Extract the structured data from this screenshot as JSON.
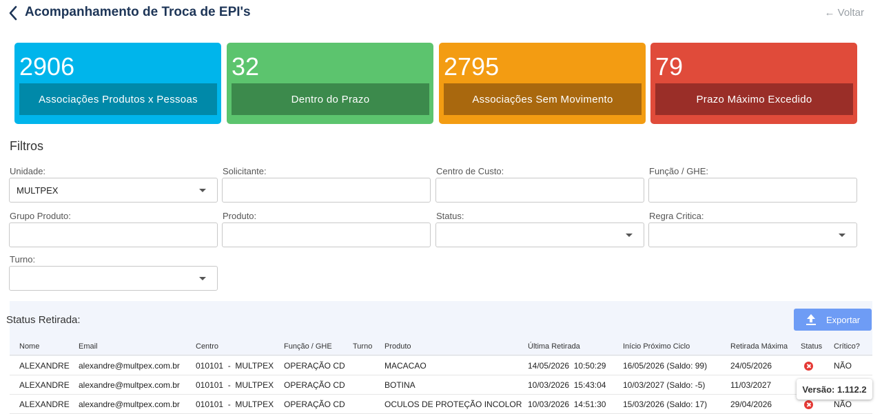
{
  "header": {
    "title": "Acompanhamento de Troca de EPI's",
    "back_label": "← Voltar"
  },
  "cards": [
    {
      "value": "2906",
      "label": "Associações Produtos x Pessoas",
      "color": "#00b5eb",
      "label_bg": "#0089a9"
    },
    {
      "value": "32",
      "label": "Dentro do Prazo",
      "color": "#5cc46e",
      "label_bg": "#3c8a4c"
    },
    {
      "value": "2795",
      "label": "Associações Sem Movimento",
      "color": "#f39c12",
      "label_bg": "#a9680e"
    },
    {
      "value": "79",
      "label": "Prazo Máximo Excedido",
      "color": "#e04b3a",
      "label_bg": "#9a2e28"
    }
  ],
  "filters": {
    "title": "Filtros",
    "unidade": {
      "label": "Unidade:",
      "value": "MULTPEX"
    },
    "solicitante": {
      "label": "Solicitante:",
      "value": ""
    },
    "centro_custo": {
      "label": "Centro de Custo:",
      "value": ""
    },
    "funcao_ghe": {
      "label": "Função / GHE:",
      "value": ""
    },
    "grupo_produto": {
      "label": "Grupo Produto:",
      "value": ""
    },
    "produto": {
      "label": "Produto:",
      "value": ""
    },
    "status": {
      "label": "Status:",
      "value": ""
    },
    "regra_critica": {
      "label": "Regra Critica:",
      "value": ""
    },
    "turno": {
      "label": "Turno:",
      "value": ""
    }
  },
  "status_section": {
    "title": "Status Retirada:",
    "export_label": "Exportar",
    "export_icon": "upload-icon"
  },
  "table": {
    "headers": [
      "Nome",
      "Email",
      "Centro",
      "Função / GHE",
      "Turno",
      "Produto",
      "Última Retirada",
      "Início Próximo Ciclo",
      "Retirada Máxima",
      "Status",
      "Crítico?"
    ],
    "rows": [
      [
        "ALEXANDRE",
        "alexandre@multpex.com.br",
        "010101  -  MULTPEX",
        "OPERAÇÃO CD",
        "",
        "MACACAO",
        "14/05/2026  10:50:29",
        "16/05/2026 (Saldo: 99)",
        "24/05/2026",
        "x-icon",
        "NÃO"
      ],
      [
        "ALEXANDRE",
        "alexandre@multpex.com.br",
        "010101  -  MULTPEX",
        "OPERAÇÃO CD",
        "",
        "BOTINA",
        "10/03/2026  15:43:04",
        "10/03/2027 (Saldo: -5)",
        "11/03/2027",
        "",
        ""
      ],
      [
        "ALEXANDRE",
        "alexandre@multpex.com.br",
        "010101  -  MULTPEX",
        "OPERAÇÃO CD",
        "",
        "OCULOS DE PROTEÇÃO INCOLOR",
        "10/03/2026  14:51:30",
        "15/03/2026 (Saldo: 17)",
        "29/04/2026",
        "x-icon",
        "NÃO"
      ]
    ]
  },
  "version": {
    "label": "Versão: 1.112.2"
  }
}
